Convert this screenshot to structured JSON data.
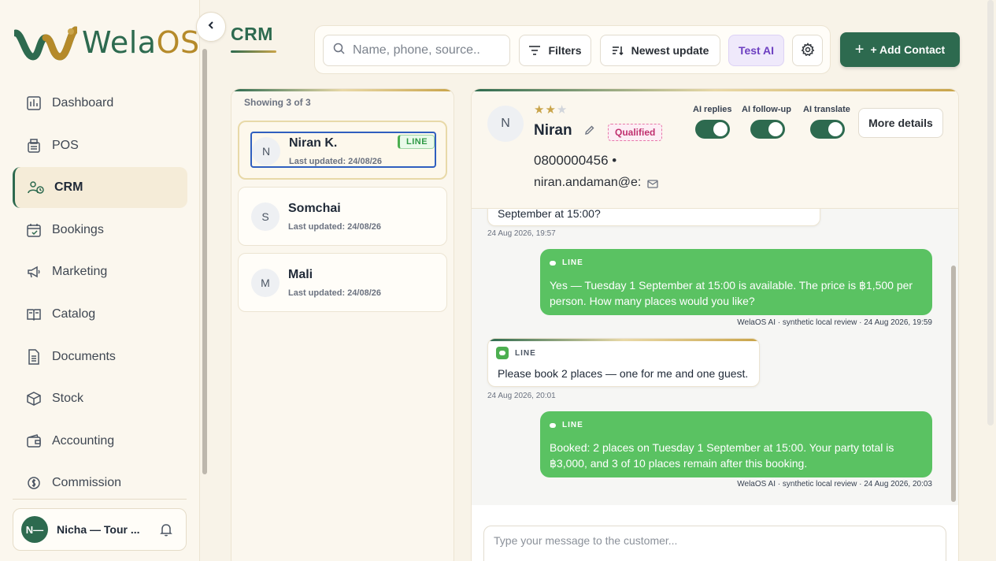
{
  "sidebar": {
    "logo_text_a": "Wela",
    "logo_text_b": "OS",
    "items": [
      {
        "label": "Dashboard",
        "icon": "dashboard-icon"
      },
      {
        "label": "POS",
        "icon": "pos-icon"
      },
      {
        "label": "CRM",
        "icon": "crm-icon",
        "active": true
      },
      {
        "label": "Bookings",
        "icon": "calendar-icon"
      },
      {
        "label": "Marketing",
        "icon": "megaphone-icon"
      },
      {
        "label": "Catalog",
        "icon": "catalog-icon"
      },
      {
        "label": "Documents",
        "icon": "document-icon"
      },
      {
        "label": "Stock",
        "icon": "box-icon"
      },
      {
        "label": "Accounting",
        "icon": "wallet-icon"
      },
      {
        "label": "Commission",
        "icon": "commission-icon"
      }
    ],
    "user": {
      "initials": "N—",
      "name": "Nicha — Tour ..."
    }
  },
  "header": {
    "title": "CRM",
    "search_placeholder": "Name, phone, source..",
    "filters_label": "Filters",
    "sort_label": "Newest update",
    "test_ai_label": "Test AI",
    "add_contact_label": "+ Add Contact"
  },
  "contacts": {
    "showing": "Showing 3 of 3",
    "items": [
      {
        "initial": "N",
        "name": "Niran K.",
        "updated": "Last updated: 24/08/26",
        "badge": "LINE",
        "selected": true
      },
      {
        "initial": "S",
        "name": "Somchai",
        "updated": "Last updated: 24/08/26"
      },
      {
        "initial": "M",
        "name": "Mali",
        "updated": "Last updated: 24/08/26"
      }
    ]
  },
  "contact_detail": {
    "initial": "N",
    "rating": 2,
    "rating_max": 3,
    "name": "Niran",
    "status": "Qualified",
    "phone": "0800000456  •",
    "email": "niran.andaman@e:",
    "toggles": [
      {
        "label": "AI replies",
        "on": true
      },
      {
        "label": "AI follow-up",
        "on": true
      },
      {
        "label": "AI translate",
        "on": true
      }
    ],
    "more_details_label": "More details"
  },
  "messages": [
    {
      "dir": "in",
      "text": "September at 15:00?",
      "time": "24 Aug 2026, 19:57"
    },
    {
      "dir": "out",
      "source": "LINE",
      "text": "Yes — Tuesday 1 September at 15:00 is available. The price is ฿1,500 per person. How many places would you like?",
      "time": "WelaOS AI · synthetic local review · 24 Aug 2026, 19:59"
    },
    {
      "dir": "in",
      "source": "LINE",
      "text": "Please book 2 places — one for me and one guest.",
      "time": "24 Aug 2026, 20:01"
    },
    {
      "dir": "out",
      "source": "LINE",
      "text": "Booked: 2 places on Tuesday 1 September at 15:00. Your party total is ฿3,000, and 3 of 10 places remain after this booking.",
      "time": "WelaOS AI · synthetic local review · 24 Aug 2026, 20:03"
    }
  ],
  "composer": {
    "placeholder": "Type your message to the customer..."
  },
  "colors": {
    "brand_green": "#2d6a4f",
    "gold": "#c9a44a",
    "bubble_green": "#5ac262",
    "test_ai_purple": "#6d3fc1",
    "qualified_pink": "#c0306f"
  }
}
